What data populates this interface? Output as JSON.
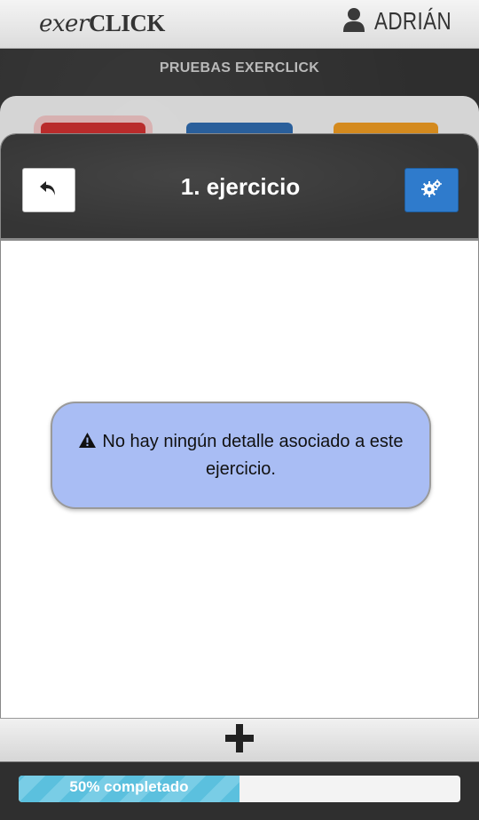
{
  "header": {
    "logo_part1": "exer",
    "logo_part2": "CLICK",
    "user_name": "ADRIÁN",
    "user_icon": "user-icon"
  },
  "subtitle": "PRUEBAS EXERCLICK",
  "background_tiles": {
    "colors": [
      "#b92b2b",
      "#2a5f9b",
      "#d48a1e"
    ]
  },
  "panel": {
    "title": "1. ejercicio",
    "back_icon": "reply-arrow-icon",
    "settings_icon": "gears-icon"
  },
  "alert": {
    "icon": "warning-icon",
    "message": "No hay ningún detalle asociado a este ejercicio."
  },
  "add_button": {
    "icon": "plus-icon"
  },
  "progress": {
    "label": "50% completado",
    "percent": 50
  },
  "colors": {
    "accent_blue": "#2f7bcc",
    "alert_bg": "#a9bdf4",
    "progress_fill": "#5bc0de"
  }
}
